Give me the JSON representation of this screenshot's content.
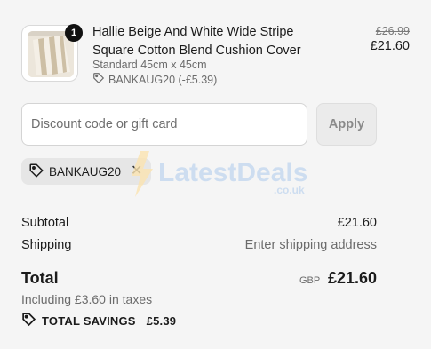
{
  "item": {
    "quantity": "1",
    "title": "Hallie Beige And White Wide Stripe Square Cotton Blend Cushion Cover",
    "variant": "Standard 45cm x 45cm",
    "discount_line": "BANKAUG20 (-£5.39)",
    "original_price": "£26.99",
    "price": "£21.60"
  },
  "discount": {
    "placeholder": "Discount code or gift card",
    "apply_label": "Apply",
    "applied_code": "BANKAUG20"
  },
  "watermark": {
    "brand_main": "LatestDeals",
    "brand_sub": ".co.uk"
  },
  "summary": {
    "subtotal_label": "Subtotal",
    "subtotal_value": "£21.60",
    "shipping_label": "Shipping",
    "shipping_value": "Enter shipping address",
    "total_label": "Total",
    "currency": "GBP",
    "total_value": "£21.60",
    "taxes_note": "Including £3.60 in taxes",
    "savings_label": "TOTAL SAVINGS",
    "savings_value": "£5.39"
  },
  "icons": {
    "tag": "tag-icon",
    "close": "close-icon"
  }
}
